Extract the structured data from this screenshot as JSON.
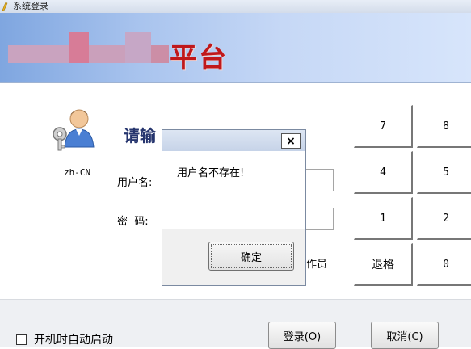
{
  "window": {
    "title": "系统登录"
  },
  "banner": {
    "title_visible": "平台"
  },
  "login": {
    "language": "zh-CN",
    "prompt_visible": "请输",
    "username_label": "用户名:",
    "password_label": "密  码:",
    "operator_suffix": "作员"
  },
  "keypad": {
    "keys": [
      "7",
      "8",
      "4",
      "5",
      "1",
      "2",
      "退格",
      "0"
    ]
  },
  "footer": {
    "autostart_label": "开机时自动启动",
    "autostart_checked": false,
    "login_button": "登录(O)",
    "cancel_button": "取消(C)"
  },
  "dialog": {
    "close_glyph": "×",
    "message": "用户名不存在!",
    "ok_button": "确定"
  },
  "colors": {
    "banner_accent": "#c0181b",
    "prompt": "#26356e",
    "dialog_title_bar": "#c6d3e8"
  }
}
